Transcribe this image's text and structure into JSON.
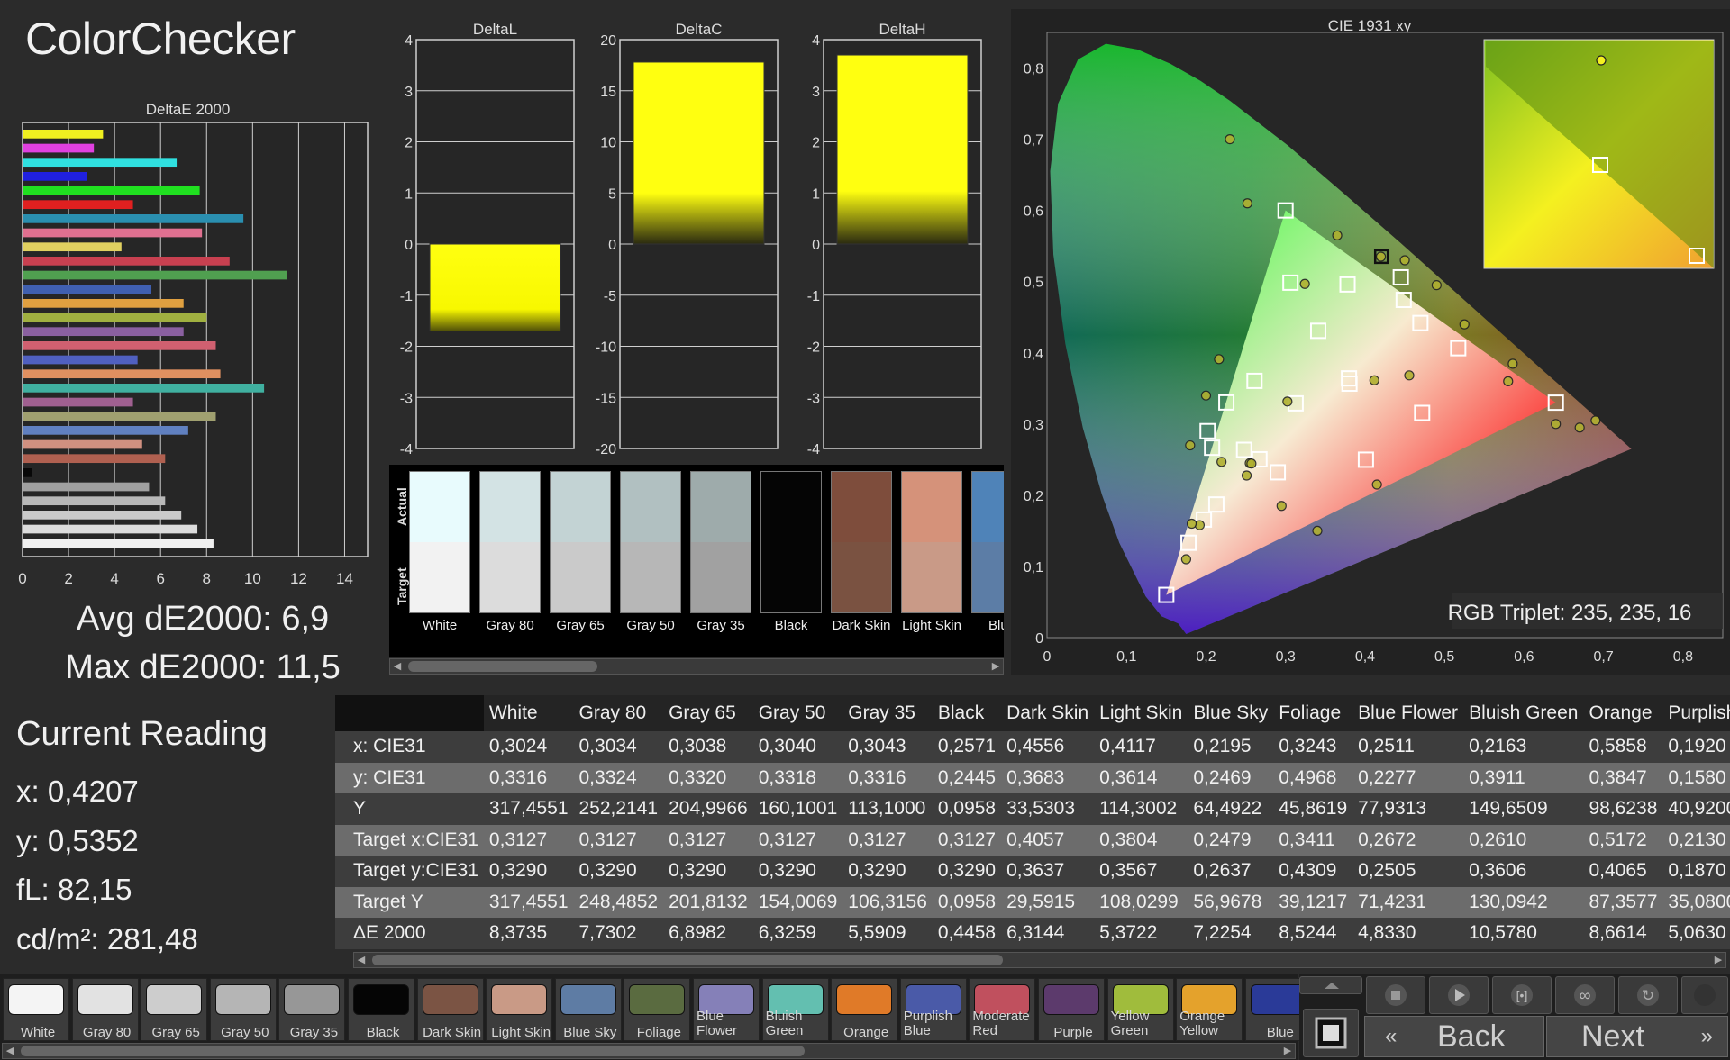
{
  "app": {
    "title": "ColorChecker"
  },
  "summary": {
    "avg": "Avg dE2000: 6,9",
    "max": "Max dE2000: 11,5"
  },
  "current_reading": {
    "title": "Current Reading",
    "x": "x: 0,4207",
    "y": "y: 0,5352",
    "fl": "fL: 82,15",
    "cdm2": "cd/m²: 281,48"
  },
  "gamut": {
    "title": "CIE 1931 xy",
    "rgb_triplet": "RGB Triplet: 235, 235, 16"
  },
  "swatch_panel": {
    "actual_label": "Actual",
    "target_label": "Target",
    "swatches": [
      {
        "name": "White",
        "actual": "#e8fbfd",
        "target": "#f2f2f2"
      },
      {
        "name": "Gray 80",
        "actual": "#d3e3e4",
        "target": "#dcdcdc"
      },
      {
        "name": "Gray 65",
        "actual": "#c3d3d4",
        "target": "#cacaca"
      },
      {
        "name": "Gray 50",
        "actual": "#b1c0c1",
        "target": "#b7b7b7"
      },
      {
        "name": "Gray 35",
        "actual": "#9eabab",
        "target": "#a1a1a1"
      },
      {
        "name": "Black",
        "actual": "#050505",
        "target": "#050505"
      },
      {
        "name": "Dark Skin",
        "actual": "#7e4d3c",
        "target": "#7a5241"
      },
      {
        "name": "Light Skin",
        "actual": "#d5927a",
        "target": "#c99a87"
      },
      {
        "name": "Blue",
        "actual": "#4f83b8",
        "target": "#5c7da6"
      }
    ]
  },
  "chart_data": [
    {
      "type": "bar",
      "orientation": "horizontal",
      "title": "DeltaE 2000",
      "xlim": [
        0,
        15
      ],
      "xticks": [
        "0",
        "2",
        "4",
        "6",
        "8",
        "10",
        "12",
        "14"
      ],
      "values": [
        3.5,
        3.1,
        6.7,
        2.8,
        7.7,
        4.8,
        9.6,
        7.8,
        4.3,
        9.0,
        11.5,
        5.6,
        7.0,
        8.0,
        7.0,
        8.4,
        5.0,
        8.6,
        10.5,
        4.8,
        8.4,
        7.2,
        5.2,
        6.2,
        0.4,
        5.5,
        6.2,
        6.9,
        7.6,
        8.3
      ],
      "colors": [
        "#f0f020",
        "#e040e0",
        "#30e0e0",
        "#2020e0",
        "#20e020",
        "#e02020",
        "#2a8fb0",
        "#e07090",
        "#e0d060",
        "#c84050",
        "#50a050",
        "#4060b0",
        "#e0a040",
        "#a0b040",
        "#8a60a0",
        "#d06070",
        "#5060c0",
        "#e09060",
        "#40b0a0",
        "#a06090",
        "#a0a070",
        "#6080c0",
        "#d09080",
        "#b06050",
        "#080808",
        "#a0a0a0",
        "#b8b8b8",
        "#cacaca",
        "#dcdcdc",
        "#f0f0f0"
      ]
    },
    {
      "type": "bar",
      "title": "DeltaL",
      "ylim": [
        -4,
        4
      ],
      "yticks": [
        "4",
        "3",
        "2",
        "1",
        "0",
        "-1",
        "-2",
        "-3",
        "-4"
      ],
      "values": [
        -1.7
      ]
    },
    {
      "type": "bar",
      "title": "DeltaC",
      "ylim": [
        -20,
        20
      ],
      "yticks": [
        "20",
        "15",
        "10",
        "5",
        "0",
        "-5",
        "-10",
        "-15",
        "-20"
      ],
      "values": [
        17.8
      ]
    },
    {
      "type": "bar",
      "title": "DeltaH",
      "ylim": [
        -4,
        4
      ],
      "yticks": [
        "4",
        "3",
        "2",
        "1",
        "0",
        "-1",
        "-2",
        "-3",
        "-4"
      ],
      "values": [
        3.7
      ]
    },
    {
      "type": "scatter",
      "title": "CIE 1931 xy",
      "xlim": [
        0,
        0.85
      ],
      "ylim": [
        0,
        0.85
      ],
      "xticks": [
        "0",
        "0,1",
        "0,2",
        "0,3",
        "0,4",
        "0,5",
        "0,6",
        "0,7",
        "0,8"
      ],
      "yticks": [
        "0",
        "0,1",
        "0,2",
        "0,3",
        "0,4",
        "0,5",
        "0,6",
        "0,7",
        "0,8"
      ],
      "gamut_triangle": [
        [
          0.64,
          0.33
        ],
        [
          0.3,
          0.6
        ],
        [
          0.15,
          0.06
        ]
      ],
      "targets": [
        [
          0.3,
          0.6
        ],
        [
          0.64,
          0.33
        ],
        [
          0.15,
          0.06
        ],
        [
          0.3127,
          0.329
        ],
        [
          0.3804,
          0.3567
        ],
        [
          0.2479,
          0.2637
        ],
        [
          0.3411,
          0.4309
        ],
        [
          0.2672,
          0.2505
        ],
        [
          0.261,
          0.3606
        ],
        [
          0.5172,
          0.4065
        ],
        [
          0.213,
          0.187
        ],
        [
          0.4718,
          0.3156
        ],
        [
          0.2902,
          0.2322
        ],
        [
          0.378,
          0.496
        ],
        [
          0.4696,
          0.4419
        ],
        [
          0.1973,
          0.1658
        ],
        [
          0.4011,
          0.2499
        ],
        [
          0.3062,
          0.4985
        ],
        [
          0.4486,
          0.4743
        ],
        [
          0.3798,
          0.3641
        ],
        [
          0.2256,
          0.3303
        ],
        [
          0.2076,
          0.2667
        ],
        [
          0.178,
          0.1332
        ],
        [
          0.445,
          0.506
        ],
        [
          0.202,
          0.29
        ]
      ],
      "measured": [
        [
          0.23,
          0.7
        ],
        [
          0.69,
          0.305
        ],
        [
          0.175,
          0.11
        ],
        [
          0.3024,
          0.3316
        ],
        [
          0.4117,
          0.3614
        ],
        [
          0.2195,
          0.2469
        ],
        [
          0.3243,
          0.4968
        ],
        [
          0.2511,
          0.2277
        ],
        [
          0.2163,
          0.3911
        ],
        [
          0.5858,
          0.3847
        ],
        [
          0.192,
          0.158
        ],
        [
          0.64,
          0.3
        ],
        [
          0.295,
          0.185
        ],
        [
          0.365,
          0.565
        ],
        [
          0.45,
          0.53
        ],
        [
          0.182,
          0.16
        ],
        [
          0.415,
          0.215
        ],
        [
          0.252,
          0.61
        ],
        [
          0.49,
          0.495
        ],
        [
          0.525,
          0.44
        ],
        [
          0.2,
          0.34
        ],
        [
          0.18,
          0.27
        ],
        [
          0.34,
          0.15
        ],
        [
          0.42,
          0.535
        ],
        [
          0.255,
          0.245
        ],
        [
          0.2571,
          0.2445
        ],
        [
          0.4556,
          0.3683
        ],
        [
          0.58,
          0.36
        ],
        [
          0.67,
          0.295
        ]
      ],
      "current_point": [
        0.4207,
        0.5352
      ]
    }
  ],
  "table": {
    "columns": [
      "White",
      "Gray 80",
      "Gray 65",
      "Gray 50",
      "Gray 35",
      "Black",
      "Dark Skin",
      "Light Skin",
      "Blue Sky",
      "Foliage",
      "Blue Flower",
      "Bluish Green",
      "Orange",
      "Purplish"
    ],
    "rows": [
      {
        "label": "x: CIE31",
        "values": [
          "0,3024",
          "0,3034",
          "0,3038",
          "0,3040",
          "0,3043",
          "0,2571",
          "0,4556",
          "0,4117",
          "0,2195",
          "0,3243",
          "0,2511",
          "0,2163",
          "0,5858",
          "0,1920"
        ]
      },
      {
        "label": "y: CIE31",
        "values": [
          "0,3316",
          "0,3324",
          "0,3320",
          "0,3318",
          "0,3316",
          "0,2445",
          "0,3683",
          "0,3614",
          "0,2469",
          "0,4968",
          "0,2277",
          "0,3911",
          "0,3847",
          "0,1580"
        ]
      },
      {
        "label": "Y",
        "values": [
          "317,4551",
          "252,2141",
          "204,9966",
          "160,1001",
          "113,1000",
          "0,0958",
          "33,5303",
          "114,3002",
          "64,4922",
          "45,8619",
          "77,9313",
          "149,6509",
          "98,6238",
          "40,9200"
        ]
      },
      {
        "label": "Target x:CIE31",
        "values": [
          "0,3127",
          "0,3127",
          "0,3127",
          "0,3127",
          "0,3127",
          "0,3127",
          "0,4057",
          "0,3804",
          "0,2479",
          "0,3411",
          "0,2672",
          "0,2610",
          "0,5172",
          "0,2130"
        ]
      },
      {
        "label": "Target y:CIE31",
        "values": [
          "0,3290",
          "0,3290",
          "0,3290",
          "0,3290",
          "0,3290",
          "0,3290",
          "0,3637",
          "0,3567",
          "0,2637",
          "0,4309",
          "0,2505",
          "0,3606",
          "0,4065",
          "0,1870"
        ]
      },
      {
        "label": "Target Y",
        "values": [
          "317,4551",
          "248,4852",
          "201,8132",
          "154,0069",
          "106,3156",
          "0,0958",
          "29,5915",
          "108,0299",
          "56,9678",
          "39,1217",
          "71,4231",
          "130,0942",
          "87,3577",
          "35,0800"
        ]
      },
      {
        "label": "ΔE 2000",
        "values": [
          "8,3735",
          "7,7302",
          "6,8982",
          "6,3259",
          "5,5909",
          "0,4458",
          "6,3144",
          "5,3722",
          "7,2254",
          "8,5244",
          "4,8330",
          "10,5780",
          "8,6614",
          "5,0630"
        ]
      }
    ]
  },
  "patches": [
    {
      "label": "White",
      "color": "#f4f4f4"
    },
    {
      "label": "Gray 80",
      "color": "#e2e2e2"
    },
    {
      "label": "Gray 65",
      "color": "#cdcdcd"
    },
    {
      "label": "Gray 50",
      "color": "#b5b5b5"
    },
    {
      "label": "Gray 35",
      "color": "#979797"
    },
    {
      "label": "Black",
      "color": "#050505"
    },
    {
      "label": "Dark Skin",
      "color": "#7b5444"
    },
    {
      "label": "Light Skin",
      "color": "#c99a86"
    },
    {
      "label": "Blue Sky",
      "color": "#5e7ca4"
    },
    {
      "label": "Foliage",
      "color": "#5a6b40"
    },
    {
      "label": "Blue Flower",
      "color": "#8580b8"
    },
    {
      "label": "Bluish Green",
      "color": "#63bfb0"
    },
    {
      "label": "Orange",
      "color": "#e07a28"
    },
    {
      "label": "Purplish Blue",
      "color": "#4a5aa8"
    },
    {
      "label": "Moderate Red",
      "color": "#c0505e"
    },
    {
      "label": "Purple",
      "color": "#5c3a6c"
    },
    {
      "label": "Yellow Green",
      "color": "#a0bc3c"
    },
    {
      "label": "Orange Yellow",
      "color": "#e4a22c"
    },
    {
      "label": "Blue",
      "color": "#2a3a98"
    }
  ],
  "controls": {
    "stop_icon": "stop-icon",
    "play_icon": "play-icon",
    "step_icon": "step-icon",
    "loop_icon": "loop-icon",
    "refresh_icon": "refresh-icon",
    "back_label": "Back",
    "next_label": "Next"
  }
}
